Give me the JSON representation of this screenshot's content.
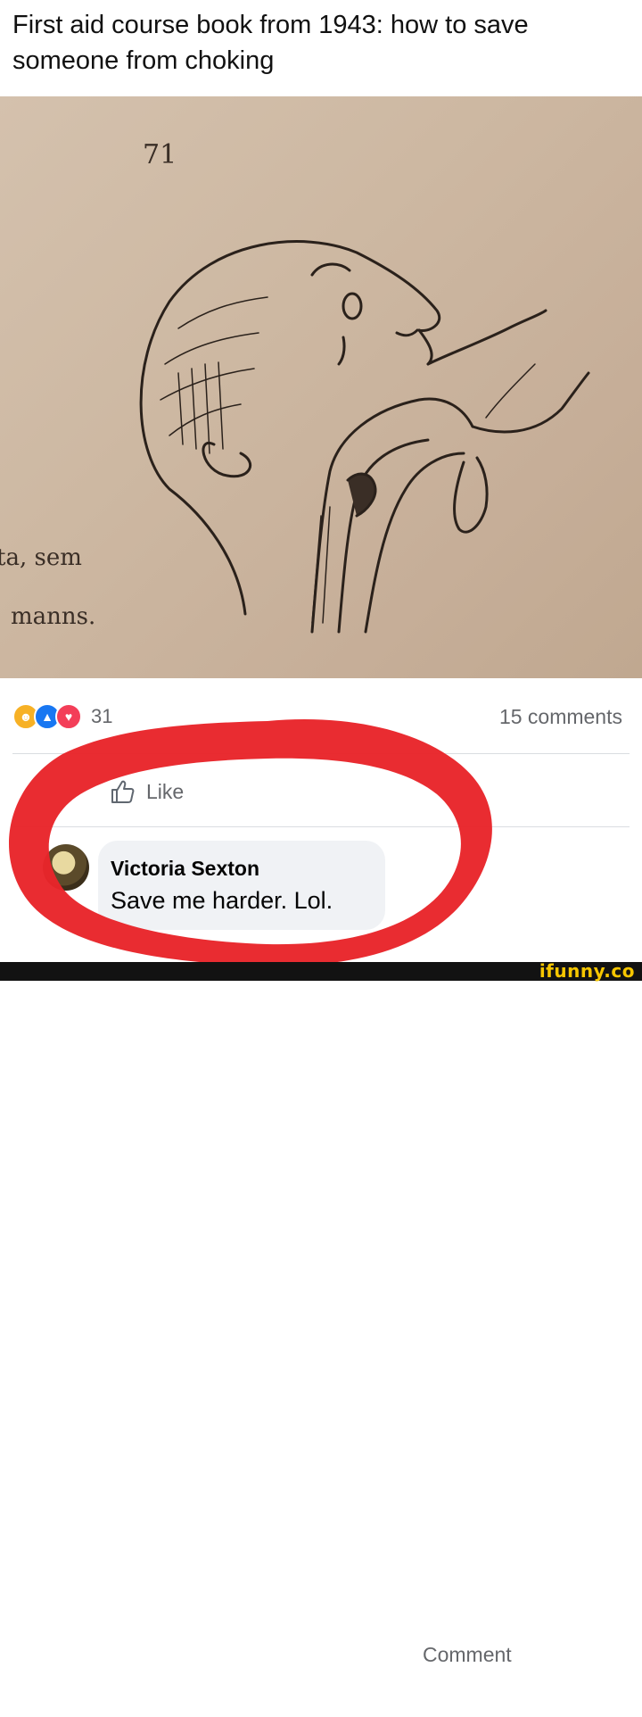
{
  "post": {
    "caption": "First aid course book from 1943: how to save someone from choking"
  },
  "photo": {
    "page_number": "71",
    "side_text_line1": "ta,   sem",
    "side_text_line2": "manns."
  },
  "reactions": {
    "icons": [
      "haha-icon",
      "like-icon",
      "love-icon"
    ],
    "count": "31",
    "comments_label": "15 comments"
  },
  "actions": {
    "like_label": "Like",
    "comment_label": "Comment"
  },
  "comment": {
    "author": "Victoria Sexton",
    "text": "Save me harder. Lol."
  },
  "footer": {
    "brand": "ifunny.co"
  },
  "colors": {
    "highlight_circle": "#e8252a",
    "brand_yellow": "#f6c600"
  }
}
